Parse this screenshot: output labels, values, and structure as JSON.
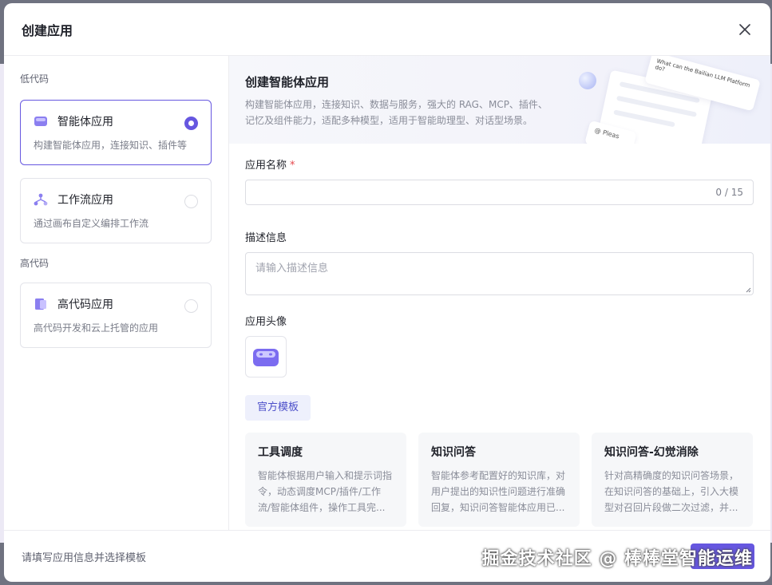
{
  "modal": {
    "title": "创建应用"
  },
  "sidebar": {
    "low_code_label": "低代码",
    "high_code_label": "高代码",
    "items": [
      {
        "title": "智能体应用",
        "desc": "构建智能体应用，连接知识、插件等",
        "selected": true,
        "icon": "agent-app-icon"
      },
      {
        "title": "工作流应用",
        "desc": "通过画布自定义编排工作流",
        "selected": false,
        "icon": "workflow-icon"
      },
      {
        "title": "高代码应用",
        "desc": "高代码开发和云上托管的应用",
        "selected": false,
        "icon": "code-app-icon"
      }
    ]
  },
  "banner": {
    "title": "创建智能体应用",
    "desc": "构建智能体应用，连接知识、数据与服务，强大的 RAG、MCP、插件、记忆及组件能力，适配多种模型，适用于智能助理型、对话型场景。",
    "art_question": "What can the Bailian LLM Platform do?",
    "art_input": "Pleas"
  },
  "form": {
    "name_label": "应用名称",
    "name_required": "*",
    "name_count": "0 / 15",
    "desc_label": "描述信息",
    "desc_placeholder": "请输入描述信息",
    "avatar_label": "应用头像"
  },
  "templates": {
    "tab_label": "官方模板",
    "cards": [
      {
        "title": "工具调度",
        "desc": "智能体根据用户输入和提示词指令，动态调度MCP/插件/工作流/智能体组件，操作工具完..."
      },
      {
        "title": "知识问答",
        "desc": "智能体参考配置好的知识库，对用户提出的知识性问题进行准确回复，知识问答智能体应用已..."
      },
      {
        "title": "知识问答-幻觉消除",
        "desc": "针对高精确度的知识问答场景，在知识问答的基础上，引入大模型对召回片段做二次过滤，并..."
      }
    ]
  },
  "footer": {
    "hint": "请填写应用信息并选择模板",
    "watermark": "掘金技术社区 @ 棒棒堂智能运维"
  },
  "colors": {
    "accent": "#6657e0",
    "required": "#e5484d",
    "template_tab_text": "#4c4fc9"
  }
}
